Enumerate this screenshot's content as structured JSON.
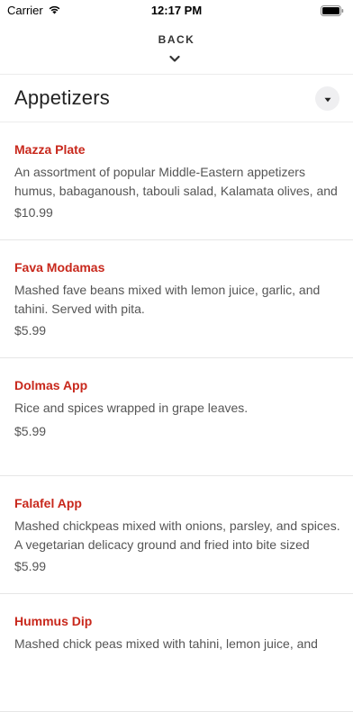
{
  "status_bar": {
    "carrier": "Carrier",
    "time": "12:17 PM"
  },
  "nav": {
    "back_label": "BACK"
  },
  "section": {
    "title": "Appetizers"
  },
  "items": [
    {
      "name": "Mazza Plate",
      "desc_lines": [
        "An assortment of popular Middle-Eastern appetizers",
        "humus, babaganoush, tabouli salad, Kalamata olives, and"
      ],
      "price": "$10.99"
    },
    {
      "name": "Fava Modamas",
      "desc_lines": [
        "Mashed fave beans mixed with lemon juice, garlic, and",
        "tahini. Served with pita."
      ],
      "price": "$5.99"
    },
    {
      "name": "Dolmas App",
      "desc_lines": [
        "Rice and spices wrapped in grape leaves."
      ],
      "price": "$5.99"
    },
    {
      "name": "Falafel App",
      "desc_lines": [
        "Mashed chickpeas mixed with onions, parsley, and spices.",
        "A vegetarian delicacy ground and fried into bite sized"
      ],
      "price": "$5.99"
    },
    {
      "name": "Hummus Dip",
      "desc_lines": [
        "Mashed chick peas mixed with tahini, lemon juice, and"
      ],
      "price": ""
    }
  ],
  "colors": {
    "item_name": "#c8281c",
    "text": "#555555",
    "divider": "#e6e6e6"
  }
}
